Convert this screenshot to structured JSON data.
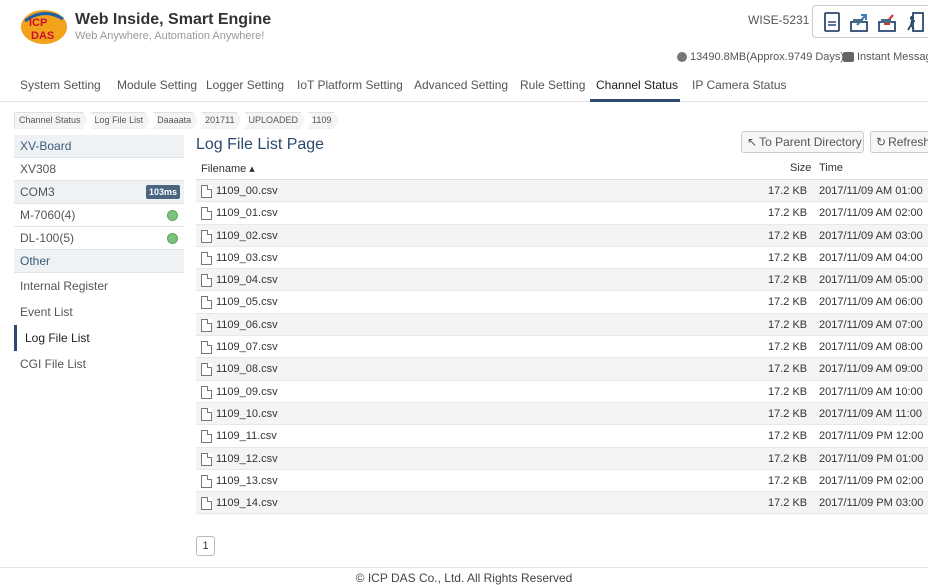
{
  "brand": {
    "title": "Web Inside, Smart Engine",
    "subtitle": "Web Anywhere, Automation Anywhere!",
    "logo_icon": "icpdas-logo"
  },
  "header": {
    "model": "WISE-5231",
    "storage": "13490.8MB(Approx.9749 Days)",
    "instant_message": "Instant Message",
    "icons": [
      "document-icon",
      "upload-icon",
      "download-icon",
      "logout-icon"
    ]
  },
  "nav": {
    "items": [
      {
        "label": "System Setting"
      },
      {
        "label": "Module Setting"
      },
      {
        "label": "Logger Setting"
      },
      {
        "label": "IoT Platform Setting"
      },
      {
        "label": "Advanced Setting"
      },
      {
        "label": "Rule Setting"
      },
      {
        "label": "Channel Status",
        "active": true
      },
      {
        "label": "IP Camera Status"
      }
    ]
  },
  "breadcrumb": [
    "Channel Status",
    "Log File List",
    "Daaaata",
    "201711",
    "UPLOADED",
    "1109"
  ],
  "sidebar": {
    "xv_board": "XV-Board",
    "xv308": "XV308",
    "com3": "COM3",
    "com3_badge": "103ms",
    "m7060": "M-7060(4)",
    "dl100": "DL-100(5)",
    "other": "Other",
    "internal_register": "Internal Register",
    "event_list": "Event List",
    "log_file_list": "Log File List",
    "cgi_file_list": "CGI File List",
    "status_color": "#7ec07e"
  },
  "main": {
    "title": "Log File List Page",
    "parent_button": "To Parent Directory",
    "refresh_button": "Refresh",
    "columns": {
      "filename": "Filename ▴",
      "size": "Size",
      "time": "Time"
    },
    "files": [
      {
        "name": "1109_00.csv",
        "size": "17.2 KB",
        "time": "2017/11/09 AM 01:00"
      },
      {
        "name": "1109_01.csv",
        "size": "17.2 KB",
        "time": "2017/11/09 AM 02:00"
      },
      {
        "name": "1109_02.csv",
        "size": "17.2 KB",
        "time": "2017/11/09 AM 03:00"
      },
      {
        "name": "1109_03.csv",
        "size": "17.2 KB",
        "time": "2017/11/09 AM 04:00"
      },
      {
        "name": "1109_04.csv",
        "size": "17.2 KB",
        "time": "2017/11/09 AM 05:00"
      },
      {
        "name": "1109_05.csv",
        "size": "17.2 KB",
        "time": "2017/11/09 AM 06:00"
      },
      {
        "name": "1109_06.csv",
        "size": "17.2 KB",
        "time": "2017/11/09 AM 07:00"
      },
      {
        "name": "1109_07.csv",
        "size": "17.2 KB",
        "time": "2017/11/09 AM 08:00"
      },
      {
        "name": "1109_08.csv",
        "size": "17.2 KB",
        "time": "2017/11/09 AM 09:00"
      },
      {
        "name": "1109_09.csv",
        "size": "17.2 KB",
        "time": "2017/11/09 AM 10:00"
      },
      {
        "name": "1109_10.csv",
        "size": "17.2 KB",
        "time": "2017/11/09 AM 11:00"
      },
      {
        "name": "1109_11.csv",
        "size": "17.2 KB",
        "time": "2017/11/09 PM 12:00"
      },
      {
        "name": "1109_12.csv",
        "size": "17.2 KB",
        "time": "2017/11/09 PM 01:00"
      },
      {
        "name": "1109_13.csv",
        "size": "17.2 KB",
        "time": "2017/11/09 PM 02:00"
      },
      {
        "name": "1109_14.csv",
        "size": "17.2 KB",
        "time": "2017/11/09 PM 03:00"
      }
    ],
    "page": "1"
  },
  "footer": "© ICP DAS Co., Ltd. All Rights Reserved"
}
